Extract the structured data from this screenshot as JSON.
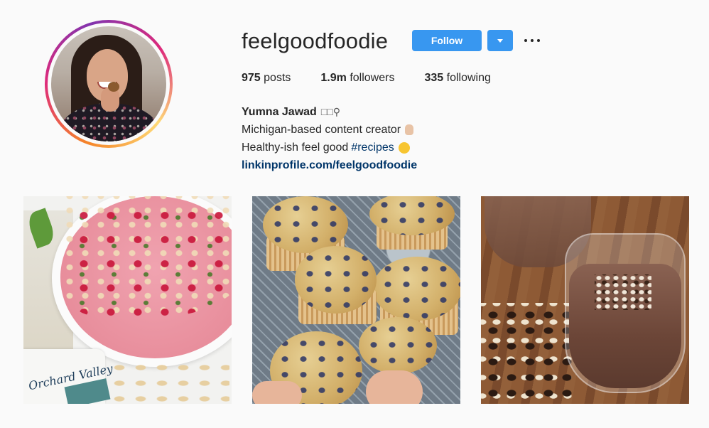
{
  "profile": {
    "username": "feelgoodfoodie",
    "follow_label": "Follow",
    "stats": {
      "posts_count": "975",
      "posts_label": "posts",
      "followers_count": "1.9m",
      "followers_label": "followers",
      "following_count": "335",
      "following_label": "following"
    },
    "bio": {
      "name": "Yumna Jawad",
      "name_icons": "□□⚲",
      "line1": "Michigan-based content creator",
      "line2_text": "Healthy-ish feel good",
      "line2_hashtag": "#recipes",
      "link": "linkinprofile.com/feelgoodfoodie"
    }
  },
  "icons": {
    "dropdown": "chevron-down-icon",
    "more": "more-options-icon",
    "line1_emoji": "raised-hand-emoji",
    "line2_emoji": "smiling-face-emoji"
  },
  "posts": [
    {
      "alt_package_text": "Orchard Valley"
    },
    {},
    {}
  ],
  "colors": {
    "accent": "#3897f0",
    "link": "#003569",
    "background": "#fafafa",
    "text": "#262626"
  }
}
